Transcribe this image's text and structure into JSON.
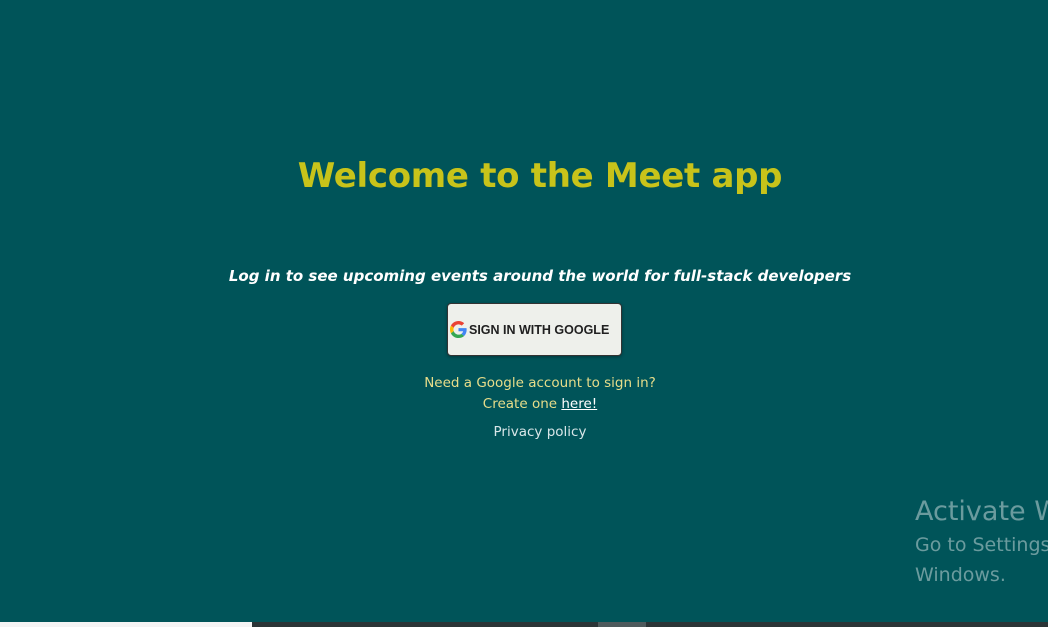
{
  "colors": {
    "background": "#005459",
    "title": "#c8c31a",
    "tagline": "#ffffff",
    "hint_text": "#e7dd8a",
    "button_bg": "#eef0eb"
  },
  "welcome": {
    "title": "Welcome to the Meet app",
    "tagline": "Log in to see upcoming events around the world for full-stack developers"
  },
  "login": {
    "google_icon": "google-g-icon",
    "button_label": "SIGN IN WITH GOOGLE",
    "need_account": "Need a Google account to sign in?",
    "create_prefix": "Create one ",
    "create_link": "here!",
    "privacy": "Privacy policy"
  },
  "watermark": {
    "title": "Activate Windows",
    "line1": "Go to Settings to activate",
    "line2": "Windows."
  }
}
